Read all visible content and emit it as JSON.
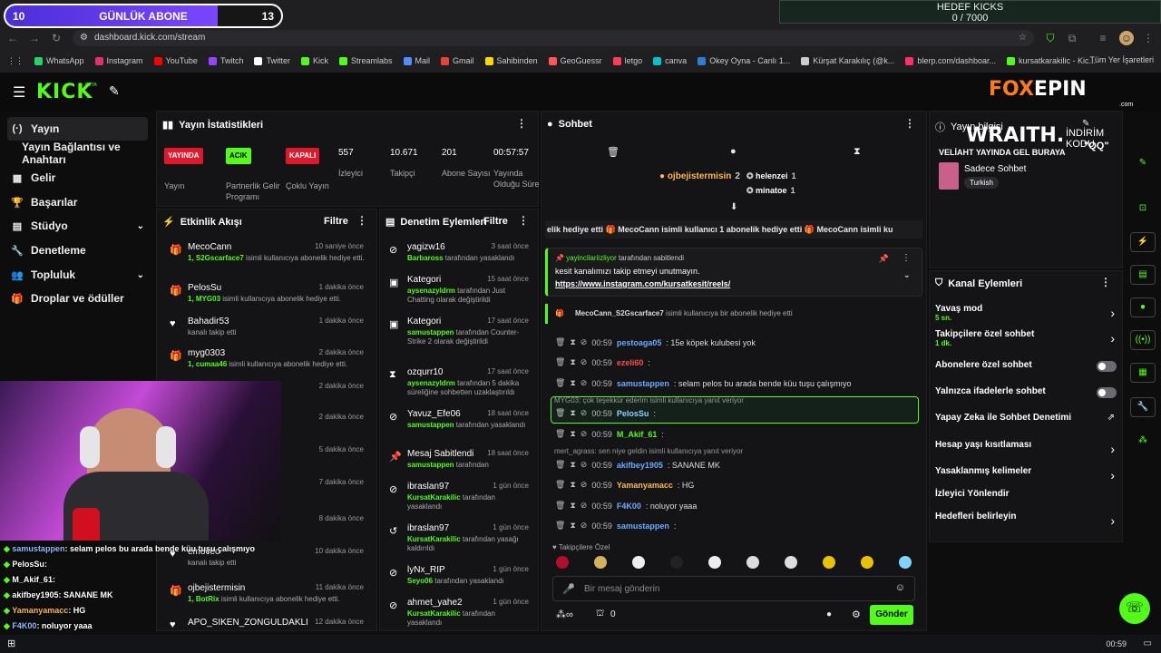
{
  "overlay": {
    "sub_left": "10",
    "sub_title": "GÜNLÜK ABONE",
    "sub_right": "13",
    "kicks_title": "HEDEF KICKS",
    "kicks_value": "0 / 7000",
    "sub_progress": 0.77
  },
  "browser": {
    "url": "dashboard.kick.com/stream",
    "bookmarks": [
      "WhatsApp",
      "Instagram",
      "YouTube",
      "Twitch",
      "Twitter",
      "Kick",
      "Streamlabs",
      "Mail",
      "Gmail",
      "Sahibinden",
      "GeoGuessr",
      "letgo",
      "canva",
      "Okey Oyna - Canlı 1...",
      "Kürşat Karakılıç (@k...",
      "blerp.com/dashboar...",
      "kursatkarakilic - Kic..."
    ],
    "bookmarks_right": "Tüm Yer İşaretleri"
  },
  "header": {
    "logo": "KICK",
    "beta": "BETA",
    "brand_a": "FOX",
    "brand_b": "EPIN",
    "brand_c": ".com"
  },
  "sidebar": {
    "items": [
      {
        "label": "Yayın",
        "icon": "(·)"
      },
      {
        "label": "Yayın Bağlantısı ve Anahtarı",
        "icon": ""
      },
      {
        "label": "Gelir",
        "icon": "▦"
      },
      {
        "label": "Başarılar",
        "icon": "🏆"
      },
      {
        "label": "Stüdyo",
        "icon": "▤"
      },
      {
        "label": "Denetleme",
        "icon": "🔧"
      },
      {
        "label": "Topluluk",
        "icon": "👥"
      },
      {
        "label": "Droplar ve ödüller",
        "icon": "🎁"
      }
    ]
  },
  "stats": {
    "title": "Yayın İstatistikleri",
    "badges": [
      {
        "text": "YAYINDA",
        "label": "Yayın"
      },
      {
        "text": "ACIK",
        "label": "Partnerlik Gelir Programı"
      },
      {
        "text": "KAPALI",
        "label": "Çoklu Yayın"
      }
    ],
    "numbers": [
      {
        "value": "557",
        "label": "İzleyici"
      },
      {
        "value": "10.671",
        "label": "Takipçi"
      },
      {
        "value": "201",
        "label": "Abone Sayısı"
      },
      {
        "value": "00:57:57",
        "label": "Yayında Olduğu Süre"
      }
    ]
  },
  "activity": {
    "title": "Etkinlik Akışı",
    "filter": "Filtre",
    "items": [
      {
        "name": "MecoCann",
        "time": "10 saniye önce",
        "desc_a": "1, S2Gscarface7",
        "desc_b": " isimli kullanıcıya abonelik hediye etti."
      },
      {
        "name": "PelosSu",
        "time": "1 dakika önce",
        "desc_a": "1, MYG03",
        "desc_b": " isimli kullanıcıya abonelik hediye etti."
      },
      {
        "name": "Bahadir53",
        "time": "1 dakika önce",
        "desc_a": "",
        "desc_b": "kanalı takip etti"
      },
      {
        "name": "myg0303",
        "time": "2 dakika önce",
        "desc_a": "1, cumaa46",
        "desc_b": " isimli kullanıcıya abonelik hediye etti."
      },
      {
        "name": "",
        "time": "2 dakika önce",
        "desc_a": "",
        "desc_b": ""
      },
      {
        "name": "",
        "time": "2 dakika önce",
        "desc_a": "",
        "desc_b": ""
      },
      {
        "name": "",
        "time": "5 dakika önce",
        "desc_a": "",
        "desc_b": ""
      },
      {
        "name": "",
        "time": "7 dakika önce",
        "desc_a": "",
        "desc_b": "a abonelik hediye"
      },
      {
        "name": "",
        "time": "8 dakika önce",
        "desc_a": "",
        "desc_b": ""
      },
      {
        "name": "emoceo",
        "time": "10 dakika önce",
        "desc_a": "",
        "desc_b": "kanalı takip etti"
      },
      {
        "name": "ojbejistermisin",
        "time": "11 dakika önce",
        "desc_a": "1, BotRix",
        "desc_b": " isimli kullanıcıya abonelik hediye etti."
      },
      {
        "name": "APO_SIKEN_ZONGULDAKLI",
        "time": "12 dakika önce",
        "desc_a": "",
        "desc_b": ""
      }
    ]
  },
  "moderation": {
    "title": "Denetim Eylemleri",
    "filter": "Filtre",
    "items": [
      {
        "name": "yagizw16",
        "time": "3 saat önce",
        "desc_a": "Barbaross",
        "desc_b": " tarafından yasaklandı"
      },
      {
        "name": "Kategori",
        "time": "15 saat önce",
        "desc_a": "aysenazyldrm",
        "desc_b": " tarafından Just Chatting olarak değiştirildi"
      },
      {
        "name": "Kategori",
        "time": "17 saat önce",
        "desc_a": "samustappen",
        "desc_b": " tarafından Counter-Strike 2 olarak değiştirildi"
      },
      {
        "name": "ozqurr10",
        "time": "17 saat önce",
        "desc_a": "aysenazyldrm",
        "desc_b": " tarafından 5 dakika süreliğine sohbetten uzaklaştırıldı"
      },
      {
        "name": "Yavuz_Efe06",
        "time": "18 saat önce",
        "desc_a": "samustappen",
        "desc_b": " tarafından yasaklandı"
      },
      {
        "name": "Mesaj Sabitlendi",
        "time": "18 saat önce",
        "desc_a": "samustappen",
        "desc_b": " tarafından"
      },
      {
        "name": "ibraslan97",
        "time": "1 gün önce",
        "desc_a": "KursatKarakilic",
        "desc_b": " tarafından yasaklandı"
      },
      {
        "name": "ibraslan97",
        "time": "1 gün önce",
        "desc_a": "KursatKarakilic",
        "desc_b": " tarafından yasağı kaldırıldı"
      },
      {
        "name": "lyNx_RIP",
        "time": "1 gün önce",
        "desc_a": "Seyo06",
        "desc_b": " tarafından yasaklandı"
      },
      {
        "name": "ahmet_yahe2",
        "time": "1 gün önce",
        "desc_a": "KursatKarakilic",
        "desc_b": " tarafından yasaklandı"
      }
    ]
  },
  "chat": {
    "title": "Sohbet",
    "top_users": [
      {
        "name": "ojbejistermisin",
        "count": "2"
      },
      {
        "name": "helenzei",
        "count": "1"
      },
      {
        "name": "minatoe",
        "count": "1"
      }
    ],
    "ticker": "elik hediye etti  🎁 MecoCann isimli kullanıcı 1 abonelik hediye etti  🎁 MecoCann isimli ku",
    "pinned_by_a": "yayincilariizliyor",
    "pinned_by_b": " tarafından sabitlendi",
    "pinned_text": "kesit kanalımızı takip etmeyi unutmayın.",
    "pinned_link": "https://www.instagram.com/kursatkesit/reels/",
    "gift_line_a": "MecoCann_S2Gscarface7",
    "gift_line_b": " isimli kullanıcıya bir abonelik hediye etti",
    "messages": [
      {
        "time": "00:59",
        "user": "pestoaga05",
        "text": ": 15e köpek kulubesi yok",
        "color": "#6ea8ff"
      },
      {
        "time": "00:59",
        "user": "ezeli60",
        "text": ":",
        "color": "#ff4d4d"
      },
      {
        "time": "00:59",
        "user": "samustappen",
        "text": ": selam pelos bu arada bende küu tuşu çalışmıyo",
        "color": "#6ea8ff"
      },
      {
        "time": "00:59",
        "user": "PelosSu",
        "text": ":",
        "color": "#8fd0ff"
      },
      {
        "time": "00:59",
        "user": "M_Akif_61",
        "text": ":",
        "color": "#53fc18"
      },
      {
        "time": "00:59",
        "user": "akifbey1905",
        "text": ": SANANE MK",
        "color": "#6ea8ff"
      },
      {
        "time": "00:59",
        "user": "Yamanyamacc",
        "text": ": HG",
        "color": "#ffb84d"
      },
      {
        "time": "00:59",
        "user": "F4K00",
        "text": ": noluyor yaaa",
        "color": "#6ea8ff"
      },
      {
        "time": "00:59",
        "user": "samustappen",
        "text": ":",
        "color": "#6ea8ff"
      }
    ],
    "reply1": "MYG03: çok teşekkür ederim isimli kullanıcıya yanıt veriyor",
    "reply2": "mert_agrass: sen niye geldin isimli kullanıcıya yanıt veriyor",
    "followers_only": "Takipçilere Özel",
    "input_placeholder": "Bir mesaj gönderin",
    "send_label": "Gönder",
    "footer_count": "0"
  },
  "stream_info": {
    "title": "Yayın bilgisi",
    "stream_title": "VELİAHT YAYINDA GEL BURAYA",
    "category": "Sadece Sohbet",
    "tag": "Turkish",
    "promo_a": "WRAITH.",
    "promo_b": "İNDİRİM KODU",
    "promo_c": "\"QQ\""
  },
  "channel_actions": {
    "title": "Kanal Eylemleri",
    "items": [
      {
        "label": "Yavaş mod",
        "sub": "5 sn.",
        "control": "chevron"
      },
      {
        "label": "Takipçilere özel sohbet",
        "sub": "1 dk.",
        "control": "chevron"
      },
      {
        "label": "Abonelere özel sohbet",
        "sub": "",
        "control": "toggle"
      },
      {
        "label": "Yalnızca ifadelerle sohbet",
        "sub": "",
        "control": "toggle"
      },
      {
        "label": "Yapay Zeka ile Sohbet Denetimi",
        "sub": "",
        "control": "external"
      },
      {
        "label": "Hesap yaşı kısıtlaması",
        "sub": "",
        "control": "chevron"
      },
      {
        "label": "Yasaklanmış kelimeler",
        "sub": "",
        "control": "chevron"
      },
      {
        "label": "İzleyici Yönlendir",
        "sub": "",
        "control": ""
      },
      {
        "label": "Hedefleri belirleyin",
        "sub": "",
        "control": "chevron"
      }
    ]
  },
  "stream_chat_overlay": [
    {
      "user": "samustappen",
      "text": ": selam pelos bu arada bende küu tuşu çalışmıyo",
      "color": "#8fb8ff"
    },
    {
      "user": "PelosSu",
      "text": ":",
      "color": "#fff"
    },
    {
      "user": "M_Akif_61",
      "text": ":",
      "color": "#fff"
    },
    {
      "user": "akifbey1905",
      "text": ": SANANE MK",
      "color": "#fff"
    },
    {
      "user": "Yamanyamacc",
      "text": ": HG",
      "color": "#ffb84d"
    },
    {
      "user": "F4K00",
      "text": ": noluyor yaaa",
      "color": "#8fb8ff"
    },
    {
      "user": "samustappen",
      "text": "",
      "color": "#8fb8ff"
    }
  ],
  "taskbar": {
    "clock": "00:59"
  },
  "colors": {
    "kick_green": "#53fc18",
    "red_badge": "#e0182d",
    "accent_purple": "#7a46ff",
    "bg": "#0d0d0e"
  }
}
